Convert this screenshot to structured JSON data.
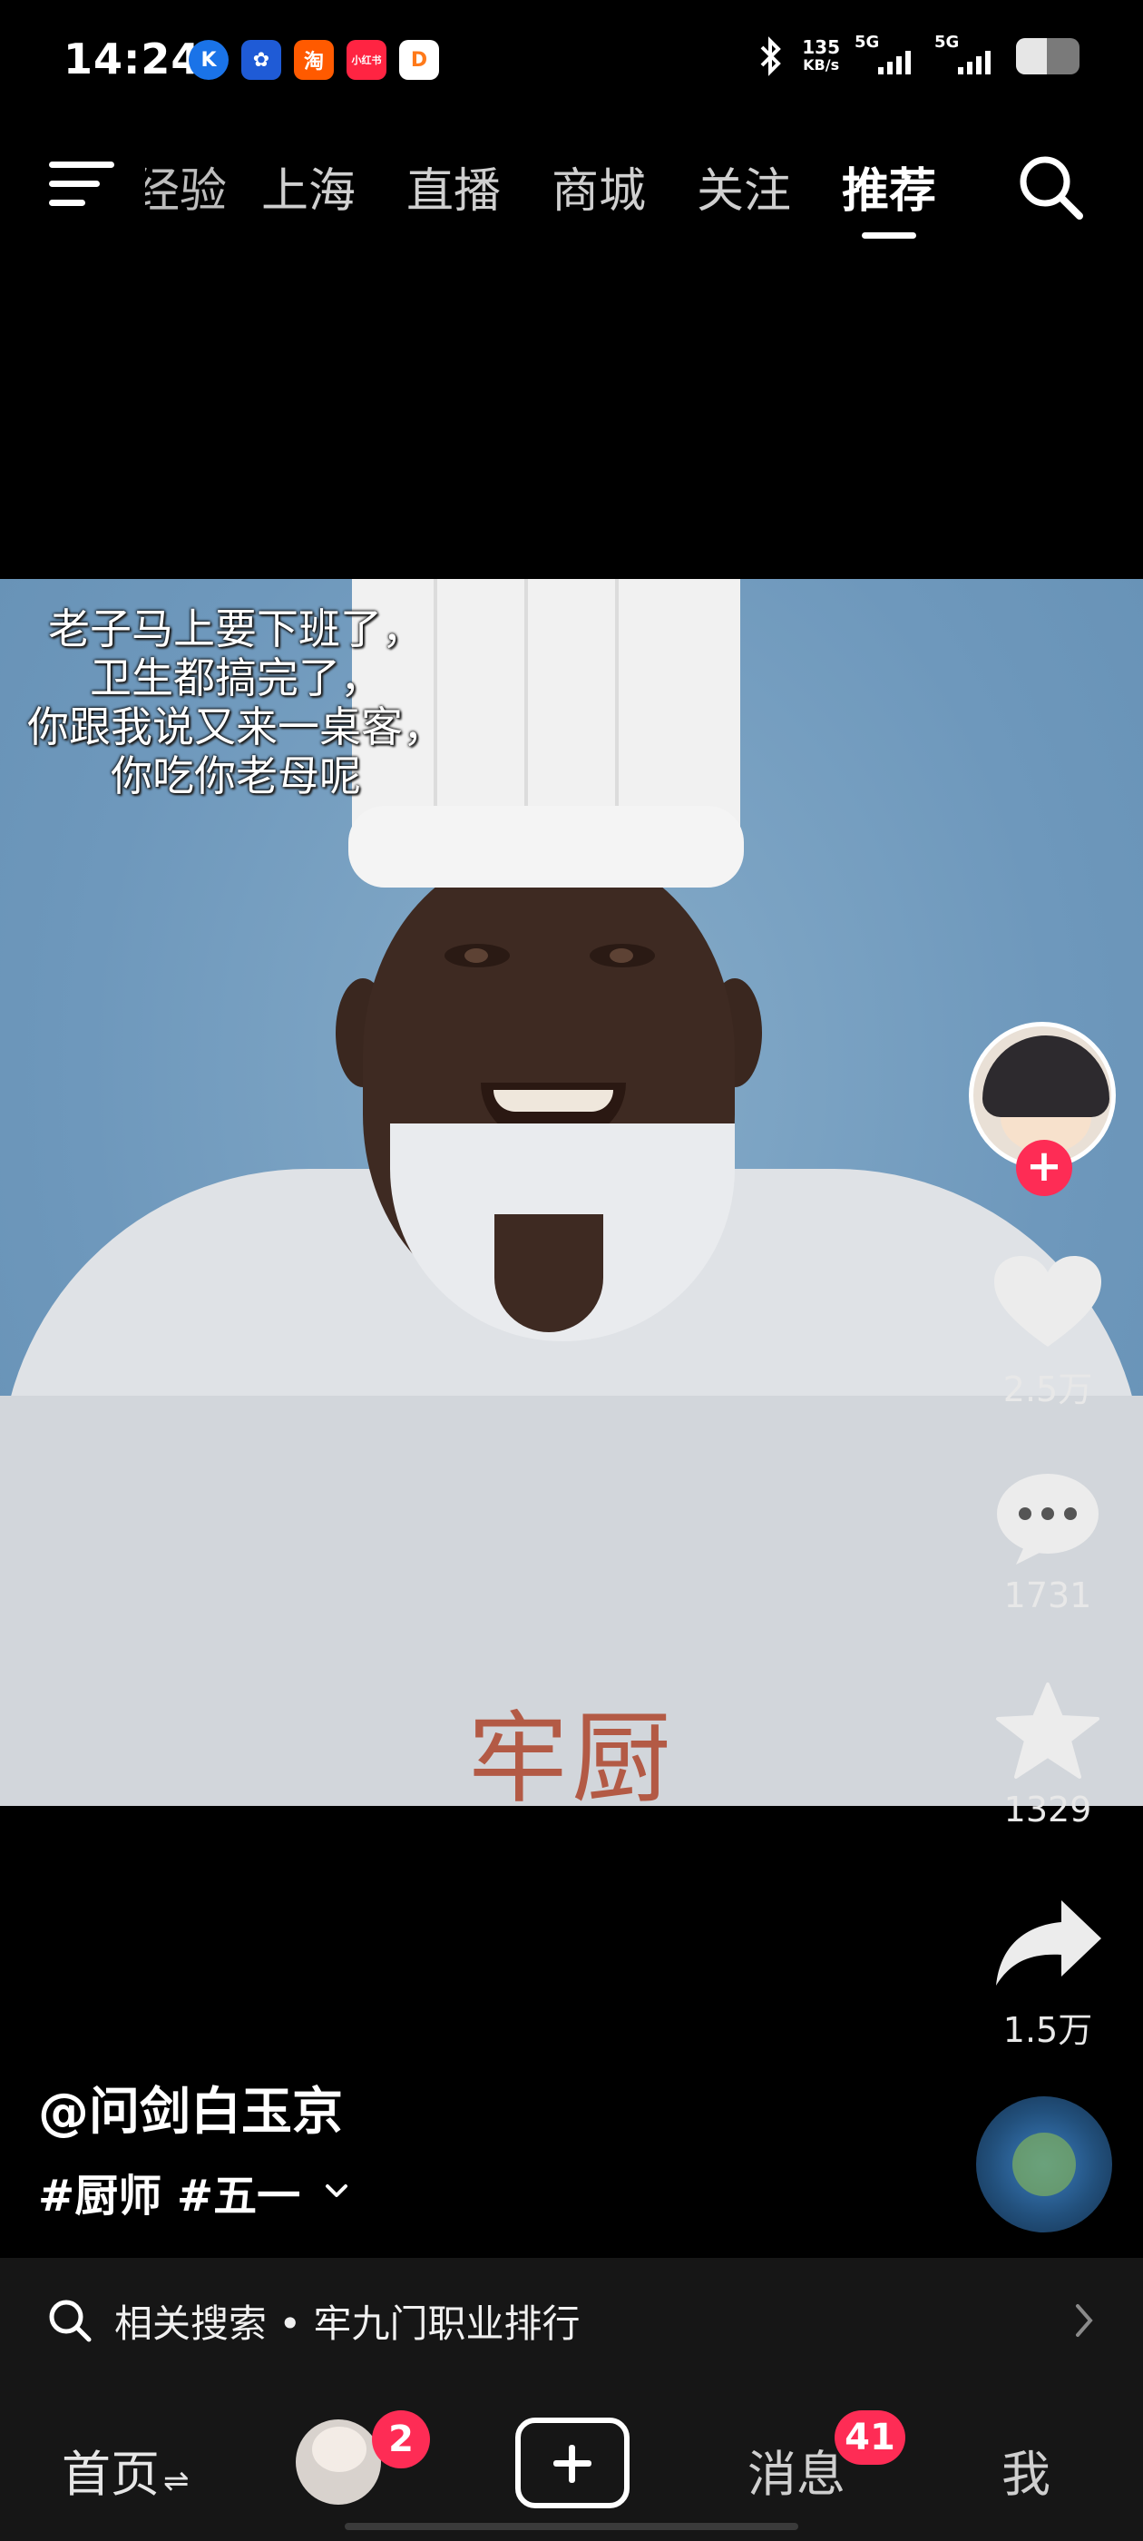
{
  "status_bar": {
    "time": "14:24",
    "notification_icons": [
      {
        "icon": "k-app-icon",
        "label": "K",
        "color": "#1a73e8"
      },
      {
        "icon": "pinwheel-app-icon",
        "label": "✿",
        "color": "#1f5bd6"
      },
      {
        "icon": "taobao-icon",
        "label": "淘",
        "color": "#ff5a00"
      },
      {
        "icon": "xiaohongshu-icon",
        "label": "小红书",
        "color": "#ff2442"
      },
      {
        "icon": "didi-icon",
        "label": "D",
        "color": "#ff7a1a"
      }
    ],
    "net_speed_value": "135",
    "net_speed_unit": "KB/s",
    "signal1_label": "5G",
    "signal2_label": "5G",
    "battery_level": 0.48
  },
  "top_nav": {
    "tabs": [
      "经验",
      "上海",
      "直播",
      "商城",
      "关注",
      "推荐"
    ],
    "active_tab": "推荐"
  },
  "video": {
    "caption_lines": [
      "老子马上要下班了，",
      "卫生都搞完了，",
      "你跟我说又来一桌客，",
      "你吃你老母呢"
    ],
    "embroidery": "牢厨"
  },
  "actions": {
    "likes": "2.5万",
    "comments": "1731",
    "favorites": "1329",
    "shares": "1.5万"
  },
  "author": "@问剑白玉京",
  "tags": "#厨师 #五一",
  "related_search": "相关搜索 • 牢九门职业排行",
  "bottom_nav": {
    "home": "首页",
    "friends_badge": "2",
    "messages": "消息",
    "messages_badge": "41",
    "me": "我"
  },
  "colors": {
    "accent": "#fe2c55",
    "video_bg": "#6f9bc0"
  }
}
